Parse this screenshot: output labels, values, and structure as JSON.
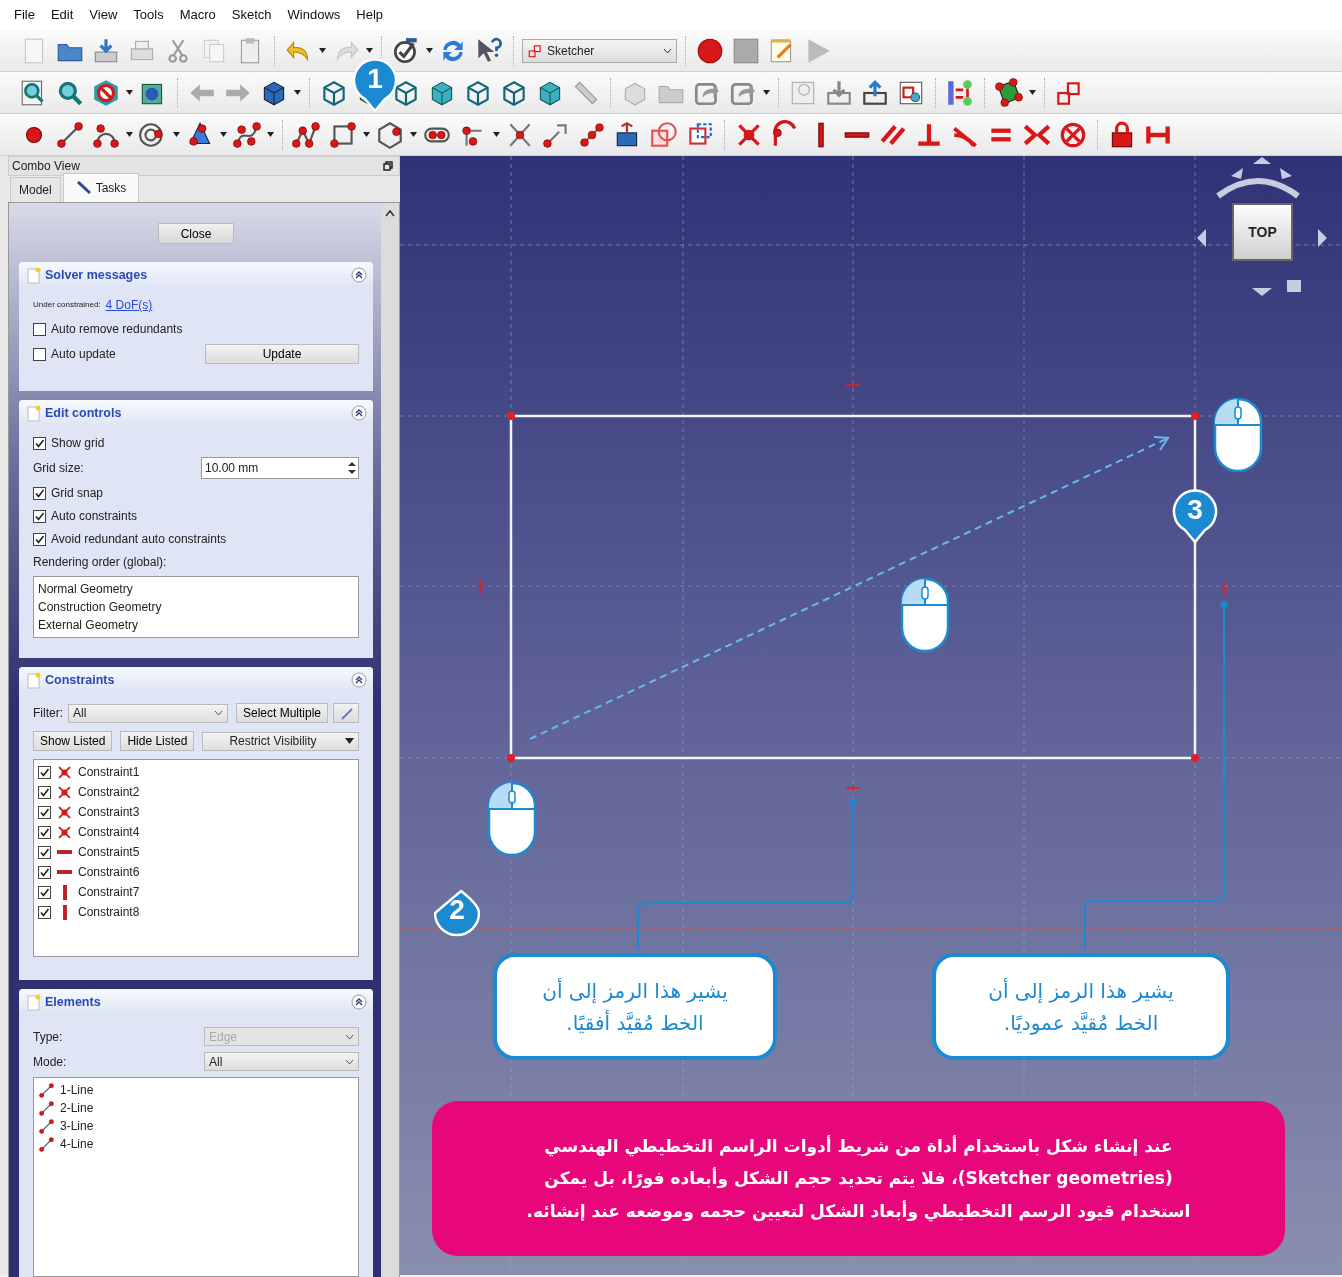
{
  "menu": [
    "File",
    "Edit",
    "View",
    "Tools",
    "Macro",
    "Sketch",
    "Windows",
    "Help"
  ],
  "toolbar": {
    "workbench": "Sketcher"
  },
  "combo_view": {
    "title": "Combo View",
    "tabs": [
      {
        "label": "Model",
        "selected": false
      },
      {
        "label": "Tasks",
        "selected": true
      }
    ],
    "close_button": "Close",
    "solver_messages": {
      "title": "Solver messages",
      "status_label": "Under constrained:",
      "dof_link": "4 DoF(s)",
      "checkboxes": [
        {
          "label": "Auto remove redundants",
          "checked": false
        },
        {
          "label": "Auto update",
          "checked": false
        }
      ],
      "update_button": "Update"
    },
    "edit_controls": {
      "title": "Edit controls",
      "items": [
        {
          "kind": "checkbox",
          "label": "Show grid",
          "checked": true
        },
        {
          "kind": "spin",
          "label": "Grid size:",
          "value": "10.00 mm"
        },
        {
          "kind": "checkbox",
          "label": "Grid snap",
          "checked": true
        },
        {
          "kind": "checkbox",
          "label": "Auto constraints",
          "checked": true
        },
        {
          "kind": "checkbox",
          "label": "Avoid redundant auto constraints",
          "checked": true
        },
        {
          "kind": "label",
          "label": "Rendering order (global):"
        },
        {
          "kind": "list",
          "items": [
            "Normal Geometry",
            "Construction Geometry",
            "External Geometry"
          ]
        }
      ]
    },
    "constraints": {
      "title": "Constraints",
      "filter_label": "Filter:",
      "filter_value": "All",
      "select_multiple": "Select Multiple",
      "buttons": [
        "Show Listed",
        "Hide Listed"
      ],
      "restrict": "Restrict Visibility",
      "items": [
        {
          "label": "Constraint1",
          "checked": true,
          "kind": "coincident"
        },
        {
          "label": "Constraint2",
          "checked": true,
          "kind": "coincident"
        },
        {
          "label": "Constraint3",
          "checked": true,
          "kind": "coincident"
        },
        {
          "label": "Constraint4",
          "checked": true,
          "kind": "coincident"
        },
        {
          "label": "Constraint5",
          "checked": true,
          "kind": "horizontal"
        },
        {
          "label": "Constraint6",
          "checked": true,
          "kind": "horizontal"
        },
        {
          "label": "Constraint7",
          "checked": true,
          "kind": "vertical"
        },
        {
          "label": "Constraint8",
          "checked": true,
          "kind": "vertical"
        }
      ]
    },
    "elements": {
      "title": "Elements",
      "type_label": "Type:",
      "type_value": "Edge",
      "type_disabled": true,
      "mode_label": "Mode:",
      "mode_value": "All",
      "items": [
        "1-Line",
        "2-Line",
        "3-Line",
        "4-Line"
      ]
    }
  },
  "canvas": {
    "nav_cube": "TOP",
    "step_badges": [
      "1",
      "2",
      "3"
    ],
    "notes": [
      {
        "text": "يشير هذا الرمز إلى أن\nالخط مُقيَّد عموديًا."
      },
      {
        "text": "يشير هذا الرمز إلى أن\nالخط مُقيَّد أفقيًا."
      }
    ],
    "summary": "عند إنشاء شكل باستخدام أداة من شريط أدوات الراسم التخطيطي الهندسي\n(Sketcher geometries)، فلا يتم تحديد حجم الشكل وأبعاده فورًا، بل يمكن\nاستخدام قيود الرسم التخطيطي وأبعاد الشكل لتعيين حجمه وموضعه عند إنشائه."
  }
}
